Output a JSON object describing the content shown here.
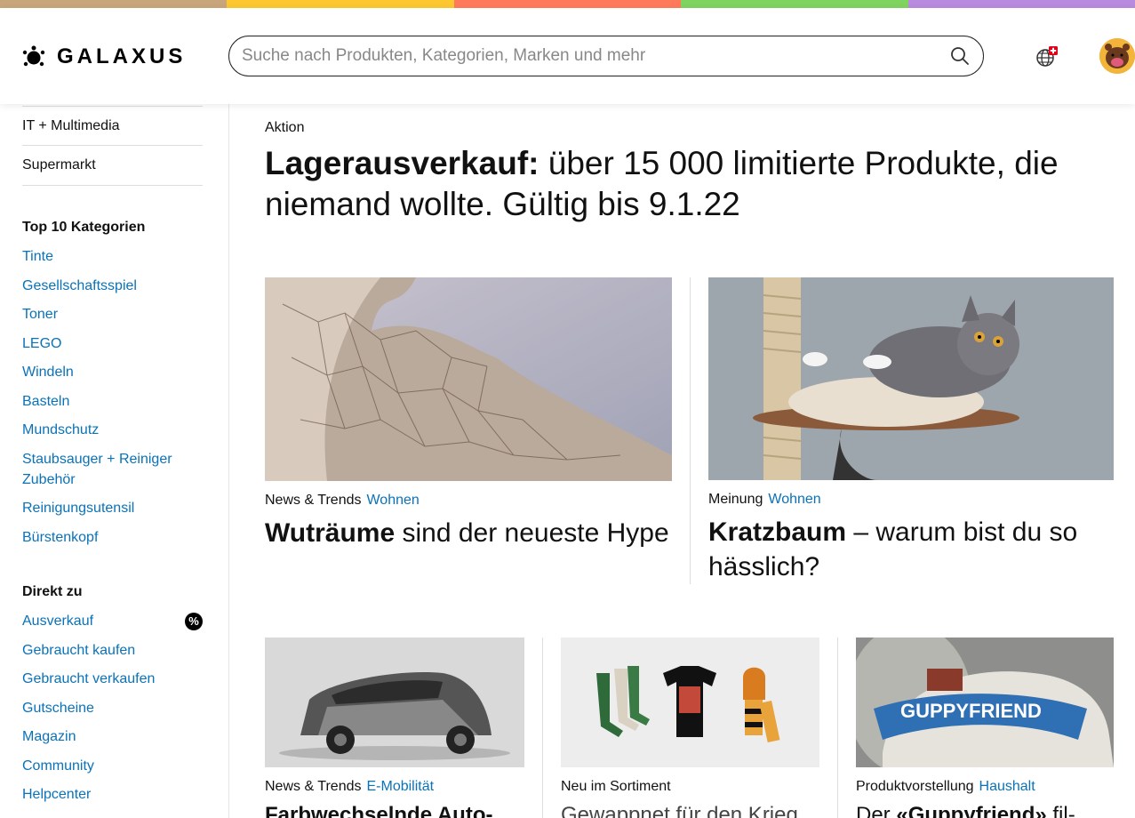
{
  "stripe_colors": [
    "#c8a57a",
    "#fdc72f",
    "#ff7a5a",
    "#7fd35f",
    "#b98bde"
  ],
  "brand": {
    "name": "GALAXUS"
  },
  "search": {
    "placeholder": "Suche nach Produkten, Kategorien, Marken und mehr"
  },
  "sidebar": {
    "top_items": [
      "IT + Multimedia",
      "Supermarkt"
    ],
    "top10_heading": "Top 10 Kategorien",
    "top10": [
      "Tinte",
      "Gesellschaftsspiel",
      "Toner",
      "LEGO",
      "Windeln",
      "Basteln",
      "Mundschutz",
      "Staubsauger + Reiniger Zubehör",
      "Reinigungsutensil",
      "Bürstenkopf"
    ],
    "direct_heading": "Direkt zu",
    "direct": [
      "Ausverkauf",
      "Gebraucht kaufen",
      "Gebraucht verkaufen",
      "Gutscheine",
      "Magazin",
      "Community",
      "Helpcenter"
    ],
    "sale_badge": "%"
  },
  "main": {
    "kicker": "Aktion",
    "headline_bold": "Lagerausverkauf:",
    "headline_rest": " über 15 000 limitierte Produkte, die niemand wollte. Gültig bis 9.1.22",
    "cards": [
      {
        "type": "News & Trends",
        "category": "Wohnen",
        "title_bold": "Wuträume",
        "title_rest": " sind der neueste Hype",
        "image": "cracked-bowl"
      },
      {
        "type": "Meinung",
        "category": "Wohnen",
        "title_bold": "Kratzbaum",
        "title_rest": " – warum bist du so hässlich?",
        "image": "cat-on-scratching-post"
      },
      {
        "type": "News & Trends",
        "category": "E-Mobilität",
        "title_bold": "Farbwechselnde Auto-",
        "title_rest": "",
        "image": "car"
      },
      {
        "type": "Neu im Sortiment",
        "category": "",
        "title_bold": "",
        "title_rest": "Gewappnet für den Krieg",
        "image": "merch"
      },
      {
        "type": "Produktvorstellung",
        "category": "Haushalt",
        "title_bold": "«Guppyfriend»",
        "title_prefix": "Der ",
        "title_rest": " fil-",
        "image": "guppyfriend-bag"
      }
    ]
  },
  "colors": {
    "link": "#0a72b8",
    "text": "#111111"
  }
}
